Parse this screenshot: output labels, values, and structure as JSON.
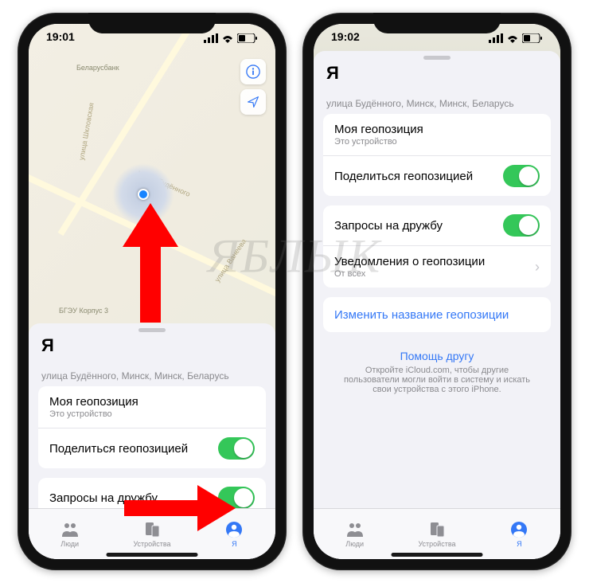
{
  "watermark": "ЯБЛЫК",
  "phone1": {
    "time": "19:01",
    "map": {
      "poi_top": "Беларусбанк",
      "poi_bottom": "БГЭУ Корпус 3",
      "street1": "улица Будённого",
      "street2": "улица Шкловская",
      "street3": "улица Ванеева"
    },
    "sheet": {
      "title": "Я",
      "address": "улица Будённого, Минск, Минск, Беларусь",
      "my_location": "Моя геопозиция",
      "my_location_sub": "Это устройство",
      "share": "Поделиться геопозицией",
      "friend_req": "Запросы на дружбу"
    },
    "tabs": {
      "people": "Люди",
      "devices": "Устройства",
      "me": "Я"
    }
  },
  "phone2": {
    "time": "19:02",
    "sheet": {
      "title": "Я",
      "address": "улица Будённого, Минск, Минск, Беларусь",
      "my_location": "Моя геопозиция",
      "my_location_sub": "Это устройство",
      "share": "Поделиться геопозицией",
      "friend_req": "Запросы на дружбу",
      "notifications": "Уведомления о геопозиции",
      "notifications_sub": "От всех",
      "rename": "Изменить название геопозиции",
      "help_link": "Помощь другу",
      "help_text": "Откройте iCloud.com, чтобы другие пользователи могли войти в систему и искать свои устройства с этого iPhone."
    },
    "tabs": {
      "people": "Люди",
      "devices": "Устройства",
      "me": "Я"
    }
  }
}
